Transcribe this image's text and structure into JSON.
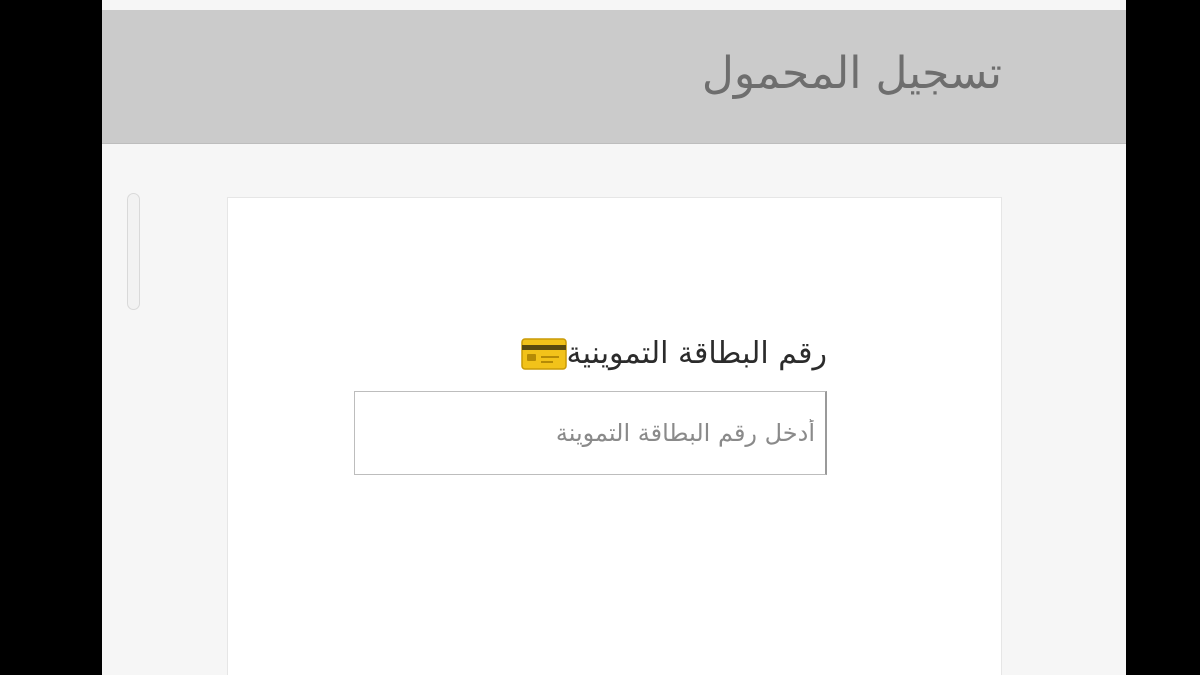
{
  "header": {
    "title": "تسجيل المحمول"
  },
  "form": {
    "ration_card_label": "رقم البطاقة التموينية",
    "ration_card_icon": "credit-card-icon",
    "ration_card_placeholder": "أدخل رقم البطاقة التموينة",
    "ration_card_value": ""
  },
  "colors": {
    "header_bg": "#cbcbcb",
    "page_bg": "#f6f6f6",
    "card_bg": "#ffffff",
    "icon_yellow": "#f2c21a"
  }
}
